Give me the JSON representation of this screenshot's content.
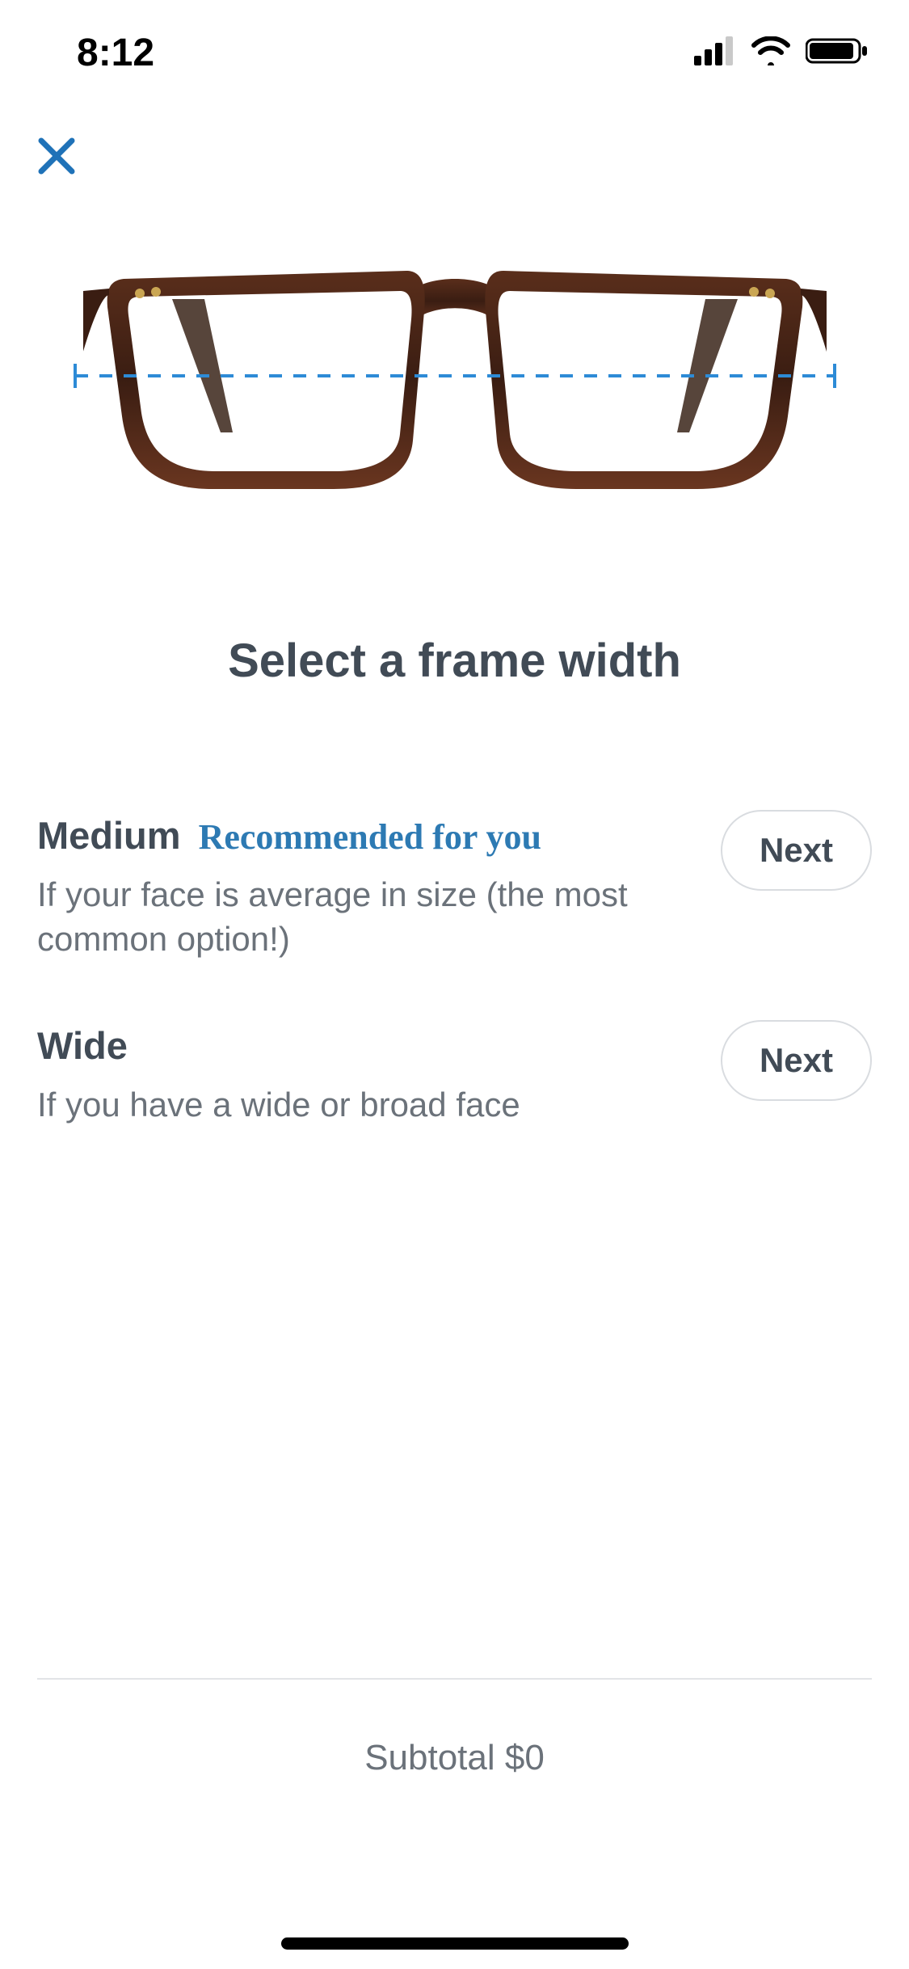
{
  "status": {
    "time": "8:12"
  },
  "title": "Select a frame width",
  "options": [
    {
      "label": "Medium",
      "recommended": "Recommended for you",
      "desc": "If your face is average in size (the most common option!)",
      "button": "Next"
    },
    {
      "label": "Wide",
      "recommended": "",
      "desc": "If you have a wide or broad face",
      "button": "Next"
    }
  ],
  "subtotal": "Subtotal $0"
}
